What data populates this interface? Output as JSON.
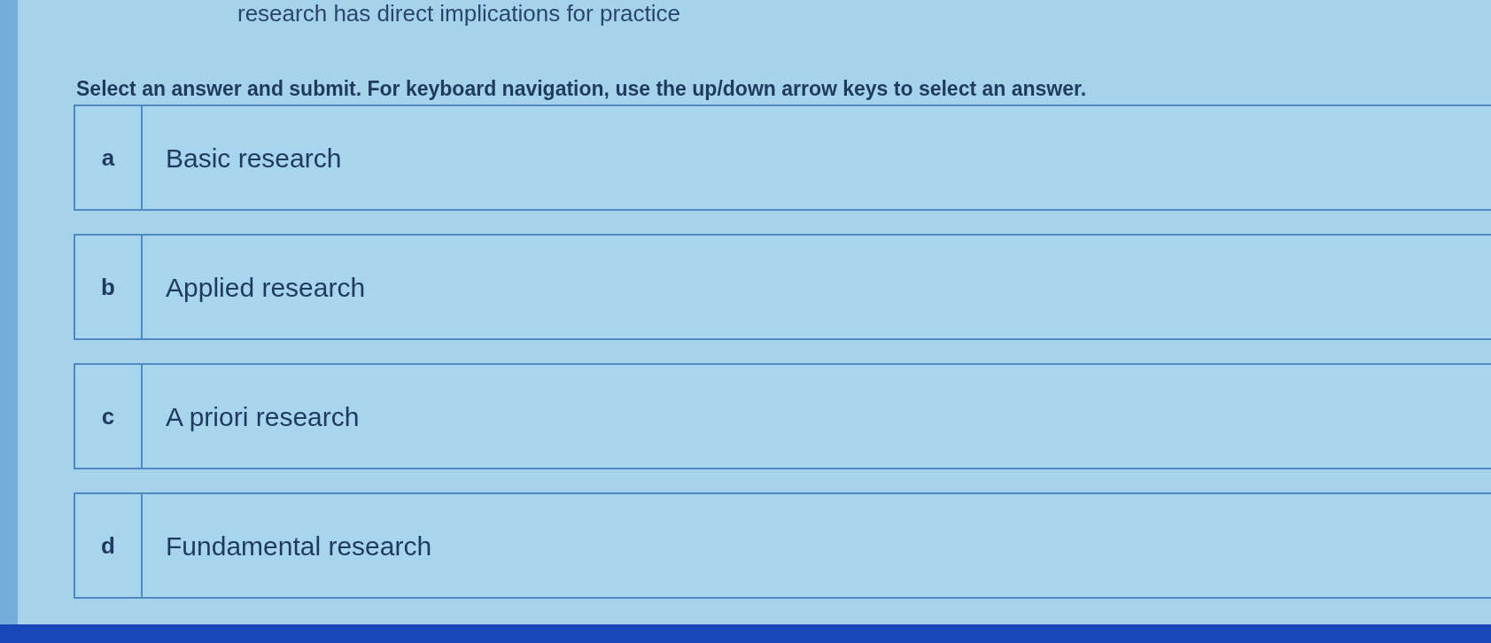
{
  "question_partial": "research has direct implications for practice",
  "instructions": "Select an answer and submit. For keyboard navigation, use the up/down arrow keys to select an answer.",
  "options": [
    {
      "letter": "a",
      "text": "Basic research",
      "selected": false
    },
    {
      "letter": "b",
      "text": "Applied research",
      "selected": false
    },
    {
      "letter": "c",
      "text": "A priori research",
      "selected": false
    },
    {
      "letter": "d",
      "text": "Fundamental research",
      "selected": false
    }
  ]
}
